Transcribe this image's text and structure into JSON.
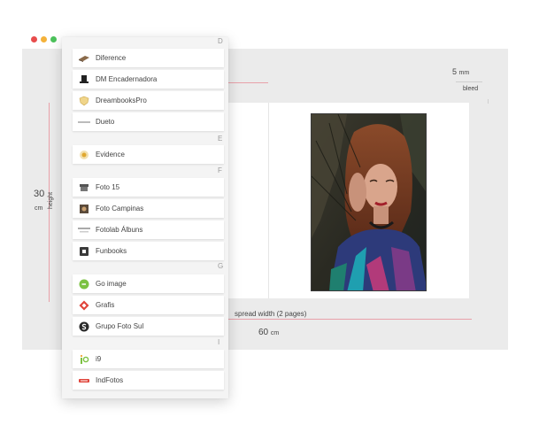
{
  "window": {
    "dots": [
      "#e84c4c",
      "#f4b23a",
      "#4cc25b"
    ]
  },
  "dimensions": {
    "bleed_value": "5",
    "bleed_unit": "mm",
    "bleed_label": "bleed",
    "height_value": "30",
    "height_unit": "cm",
    "height_label": "height",
    "width_label": "spread width (2 pages)",
    "width_value": "60",
    "width_unit": "cm"
  },
  "list": {
    "sections": [
      {
        "letter": "D",
        "items": [
          {
            "label": "Diference",
            "icon": "book-icon"
          },
          {
            "label": "DM Encadernadora",
            "icon": "top-hat-icon"
          },
          {
            "label": "DreambooksPro",
            "icon": "shield-icon"
          },
          {
            "label": "Dueto",
            "icon": "dueto-wordmark-icon"
          }
        ]
      },
      {
        "letter": "E",
        "items": [
          {
            "label": "Evidence",
            "icon": "badge-icon"
          }
        ]
      },
      {
        "letter": "F",
        "items": [
          {
            "label": "Foto 15",
            "icon": "shop-icon"
          },
          {
            "label": "Foto Campinas",
            "icon": "camera-icon"
          },
          {
            "label": "Fotolab Álbuns",
            "icon": "fotolab-wordmark-icon"
          },
          {
            "label": "Funbooks",
            "icon": "square-logo-icon"
          }
        ]
      },
      {
        "letter": "G",
        "items": [
          {
            "label": "Go image",
            "icon": "go-circle-icon"
          },
          {
            "label": "Grafis",
            "icon": "diamond-icon"
          },
          {
            "label": "Grupo Foto Sul",
            "icon": "s-circle-icon"
          }
        ]
      },
      {
        "letter": "I",
        "items": [
          {
            "label": "i9",
            "icon": "i9-logo-icon"
          },
          {
            "label": "IndFotos",
            "icon": "indfotos-logo-icon"
          }
        ]
      }
    ]
  }
}
